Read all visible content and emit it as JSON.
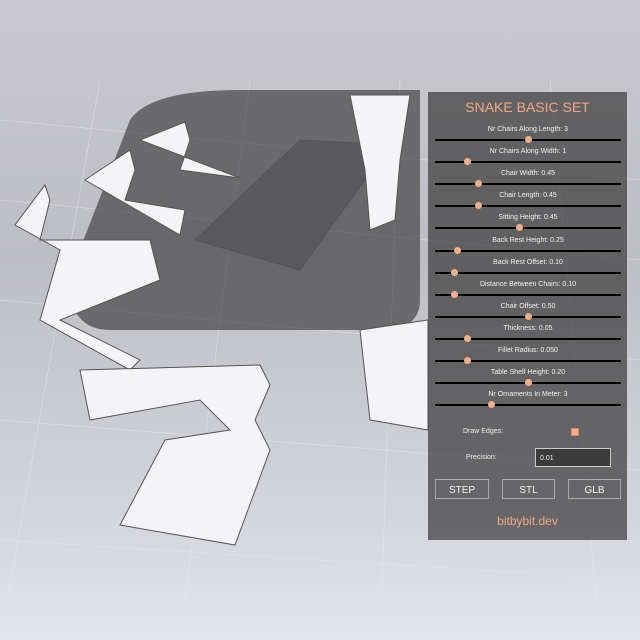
{
  "panel": {
    "title": "SNAKE BASIC SET",
    "sliders": [
      {
        "label": "Nr Chairs Along Length: 3",
        "fraction": 0.5
      },
      {
        "label": "Nr Chairs Along Width: 1",
        "fraction": 0.17
      },
      {
        "label": "Chair Width: 0.45",
        "fraction": 0.23
      },
      {
        "label": "Chair Length: 0.45",
        "fraction": 0.23
      },
      {
        "label": "Sitting Height: 0.45",
        "fraction": 0.45
      },
      {
        "label": "Back Rest Height: 0.25",
        "fraction": 0.12
      },
      {
        "label": "Back Rest Offset: 0.10",
        "fraction": 0.1
      },
      {
        "label": "Distance Between Chairs: 0.10",
        "fraction": 0.1
      },
      {
        "label": "Chair Offset: 0.50",
        "fraction": 0.5
      },
      {
        "label": "Thickness: 0.05",
        "fraction": 0.17
      },
      {
        "label": "Fillet Radius: 0.050",
        "fraction": 0.17
      },
      {
        "label": "Table Shelf Height: 0.20",
        "fraction": 0.5
      },
      {
        "label": "Nr Ornaments In Meter: 3",
        "fraction": 0.3
      }
    ],
    "draw_edges_label": "Draw Edges:",
    "draw_edges_checked": true,
    "precision_label": "Precision:",
    "precision_value": "0.01",
    "buttons": {
      "step": "STEP",
      "stl": "STL",
      "glb": "GLB"
    },
    "footer": "bitbybit.dev"
  },
  "colors": {
    "accent": "#f0a882",
    "panel_bg": "#3c3c3c"
  }
}
